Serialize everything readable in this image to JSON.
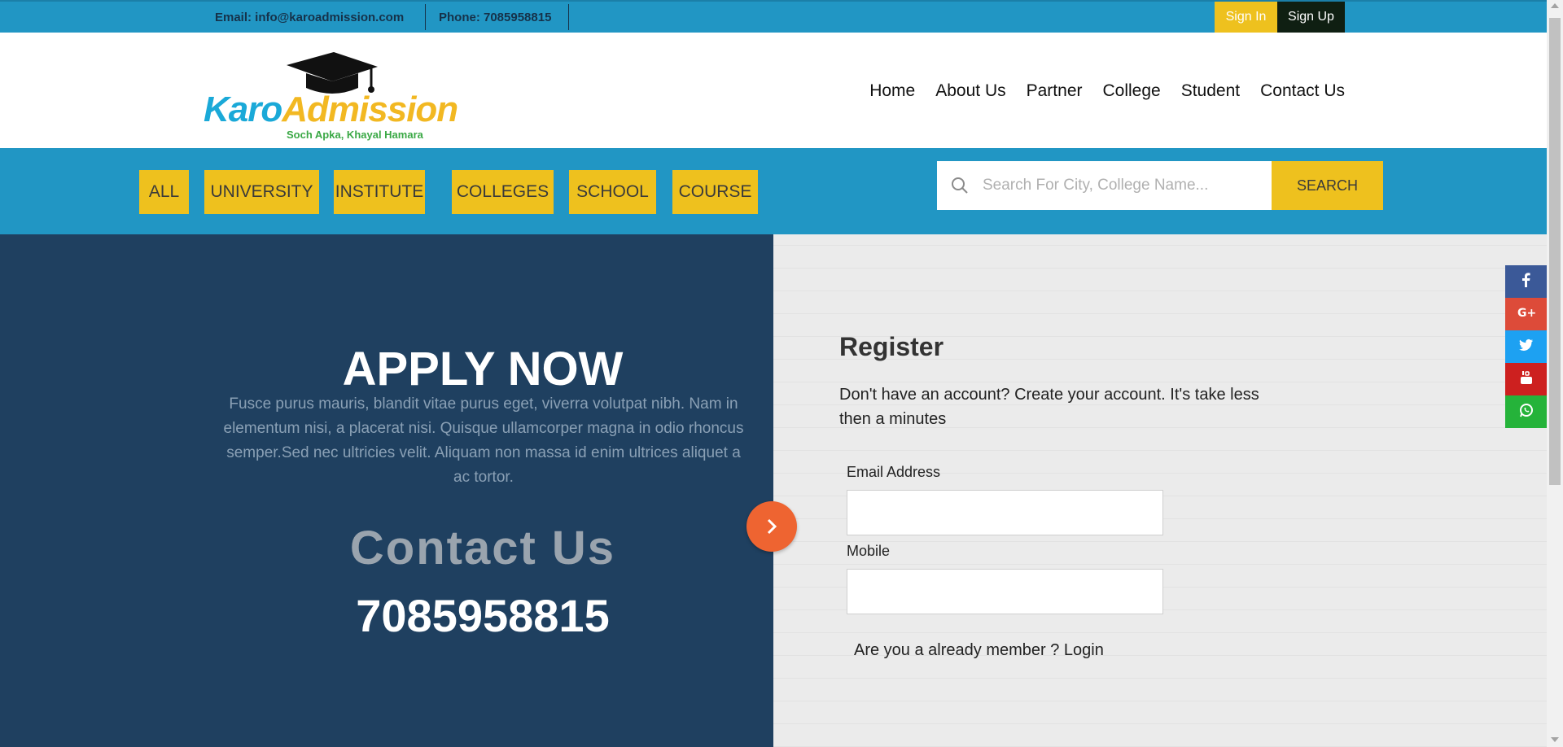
{
  "topbar": {
    "email": "Email: info@karoadmission.com",
    "phone": "Phone: 7085958815",
    "signin": "Sign In",
    "signup": "Sign Up"
  },
  "logo": {
    "part1": "Karo",
    "part2": "Admission",
    "tagline": "Soch Apka, Khayal Hamara"
  },
  "nav": [
    "Home",
    "About Us",
    "Partner",
    "College",
    "Student",
    "Contact Us"
  ],
  "categories": [
    "ALL",
    "UNIVERSITY",
    "INSTITUTE",
    "COLLEGES",
    "SCHOOL",
    "COURSE"
  ],
  "search": {
    "placeholder": "Search For City, College Name...",
    "button": "SEARCH"
  },
  "apply": {
    "title": "APPLY NOW",
    "description": "Fusce purus mauris, blandit vitae purus eget, viverra volutpat nibh. Nam in elementum nisi, a placerat nisi. Quisque ullamcorper magna in odio rhoncus semper.Sed nec ultricies velit. Aliquam non massa id enim ultrices aliquet a ac tortor.",
    "contact_title": "Contact Us",
    "contact_phone": "7085958815"
  },
  "register": {
    "title": "Register",
    "subtitle": "Don't have an account? Create your account. It's take less then a minutes",
    "email_label": "Email Address",
    "mobile_label": "Mobile",
    "login_prompt": "Are you a already member ? ",
    "login_link": "Login"
  },
  "social": [
    {
      "icon": "facebook-icon",
      "color": "#3b5998"
    },
    {
      "icon": "google-plus-icon",
      "color": "#dd4b39"
    },
    {
      "icon": "twitter-icon",
      "color": "#1da1f2"
    },
    {
      "icon": "youtube-icon",
      "color": "#cd201f"
    },
    {
      "icon": "whatsapp-icon",
      "color": "#25b33a"
    }
  ],
  "colors": {
    "primary_blue": "#2196c4",
    "accent_yellow": "#eec11e",
    "navy": "#1f4060",
    "orange": "#ee6431"
  }
}
